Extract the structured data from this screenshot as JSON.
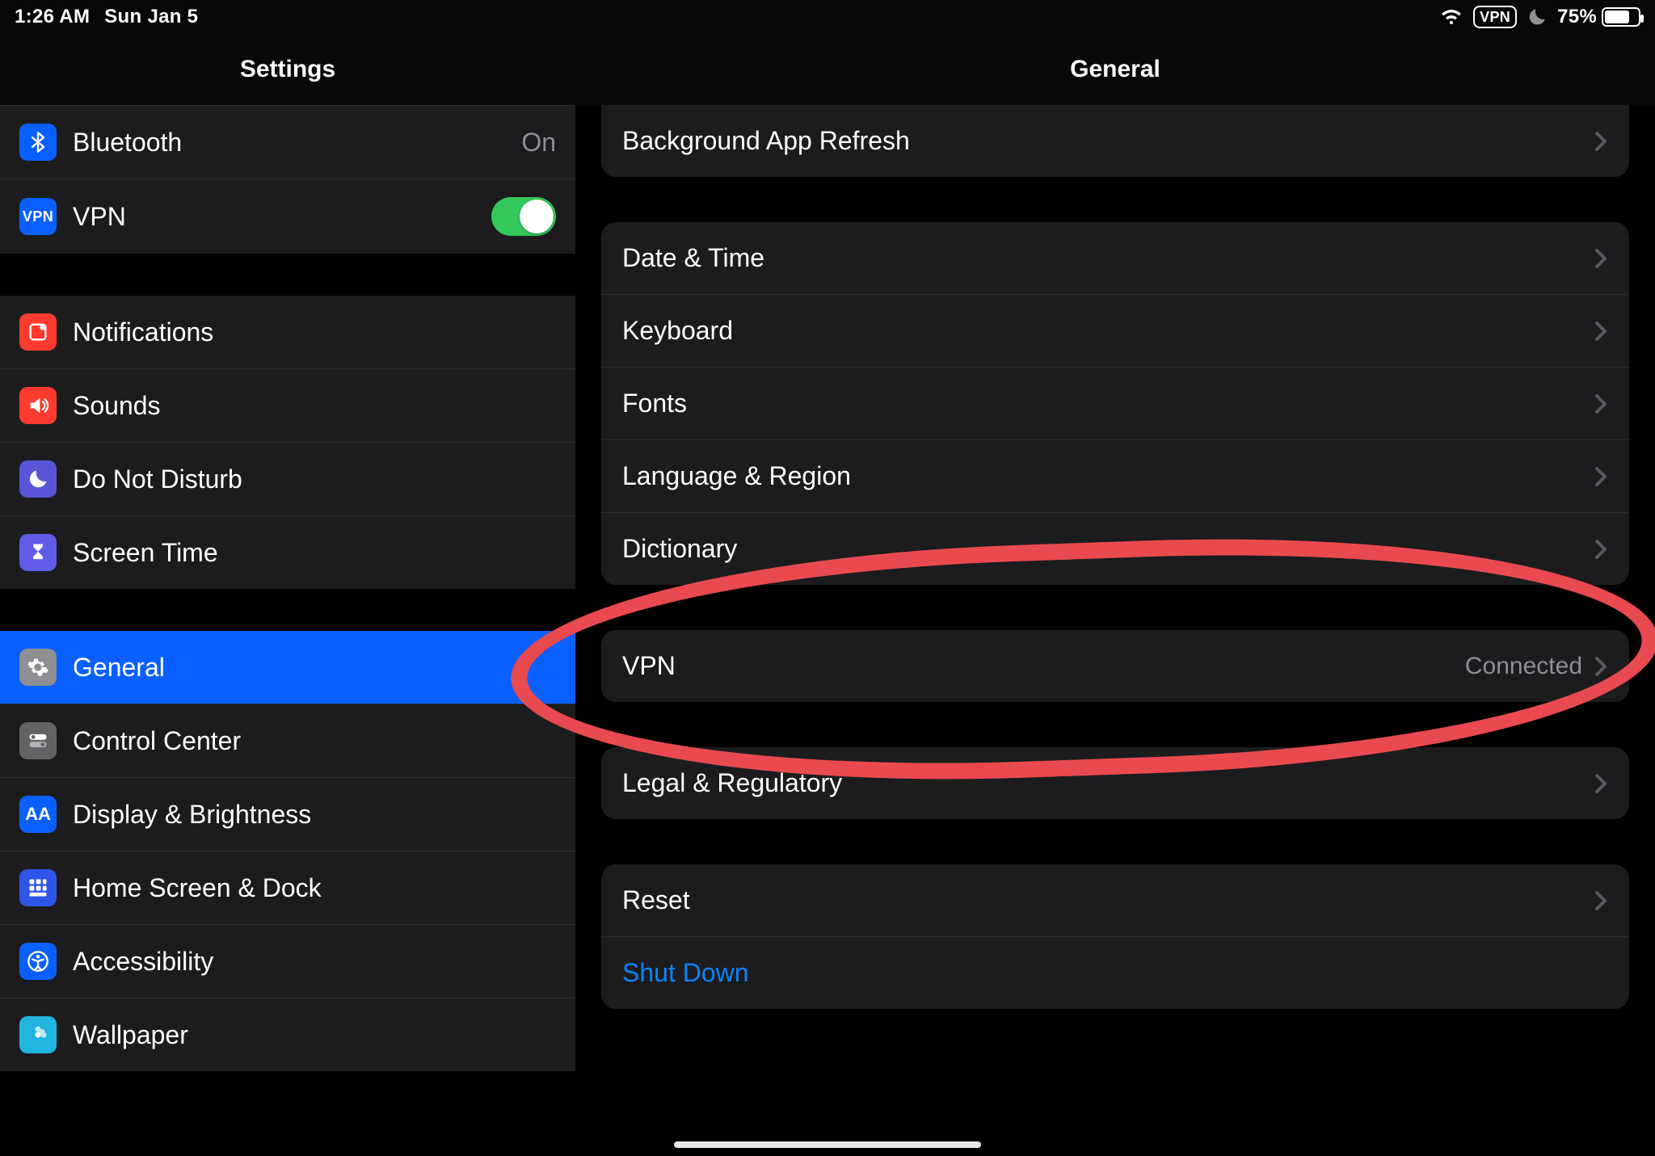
{
  "status": {
    "time": "1:26 AM",
    "date": "Sun Jan 5",
    "vpn_badge": "VPN",
    "battery_pct": "75%"
  },
  "sidebar": {
    "title": "Settings",
    "items": {
      "bluetooth": {
        "label": "Bluetooth",
        "value": "On"
      },
      "vpn": {
        "label": "VPN"
      },
      "notifications": {
        "label": "Notifications"
      },
      "sounds": {
        "label": "Sounds"
      },
      "dnd": {
        "label": "Do Not Disturb"
      },
      "screentime": {
        "label": "Screen Time"
      },
      "general": {
        "label": "General"
      },
      "controlcenter": {
        "label": "Control Center"
      },
      "display": {
        "label": "Display & Brightness"
      },
      "homescreen": {
        "label": "Home Screen & Dock"
      },
      "accessibility": {
        "label": "Accessibility"
      },
      "wallpaper": {
        "label": "Wallpaper"
      }
    }
  },
  "content": {
    "title": "General",
    "bg_refresh": "Background App Refresh",
    "datetime": "Date & Time",
    "keyboard": "Keyboard",
    "fonts": "Fonts",
    "language": "Language & Region",
    "dictionary": "Dictionary",
    "vpn": "VPN",
    "vpn_value": "Connected",
    "legal": "Legal & Regulatory",
    "reset": "Reset",
    "shutdown": "Shut Down"
  },
  "colors": {
    "accent": "#0a60ff",
    "switch_on": "#34c759",
    "link": "#0a84ff",
    "annotation": "#e84a4f"
  }
}
